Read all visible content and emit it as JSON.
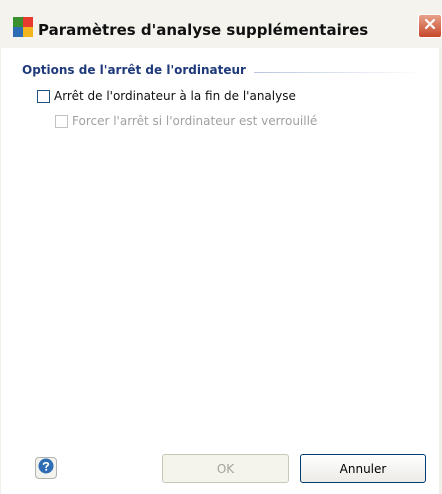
{
  "window": {
    "title": "Paramètres d'analyse supplémentaires",
    "app_icon": "avg-logo-icon",
    "close_icon": "close-icon"
  },
  "group": {
    "title": "Options de l'arrêt de l'ordinateur"
  },
  "options": [
    {
      "label": "Arrêt de l'ordinateur à la fin de l'analyse",
      "checked": false,
      "enabled": true
    },
    {
      "label": "Forcer l'arrêt si l'ordinateur est verrouillé",
      "checked": false,
      "enabled": false
    }
  ],
  "buttons": {
    "help_icon": "help-icon",
    "ok_label": "OK",
    "cancel_label": "Annuler"
  },
  "colors": {
    "group_title": "#1f3a7a",
    "close_button": "#c7472a",
    "help_blue": "#2e6db4"
  }
}
